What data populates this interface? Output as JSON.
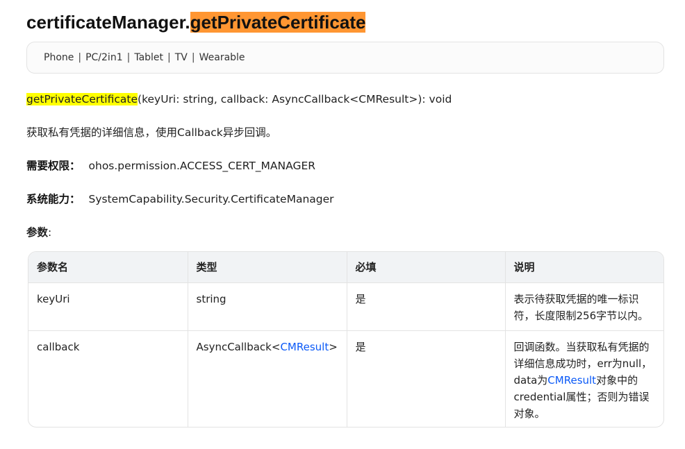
{
  "title": {
    "prefix": "certificateManager.",
    "highlight": "getPrivateCertificate"
  },
  "devices": [
    "Phone",
    "PC/2in1",
    "Tablet",
    "TV",
    "Wearable"
  ],
  "device_separator": "|",
  "signature": {
    "name": "getPrivateCertificate",
    "rest": "(keyUri: string, callback: AsyncCallback<CMResult>): void"
  },
  "description": "获取私有凭据的详细信息，使用Callback异步回调。",
  "permission": {
    "label": "需要权限：",
    "value": "ohos.permission.ACCESS_CERT_MANAGER"
  },
  "syscap": {
    "label": "系统能力：",
    "value": "SystemCapability.Security.CertificateManager"
  },
  "params_heading": {
    "label": "参数",
    "colon": ":"
  },
  "table": {
    "headers": [
      "参数名",
      "类型",
      "必填",
      "说明"
    ],
    "rows": [
      {
        "name": "keyUri",
        "type": "string",
        "required": "是",
        "desc": "表示待获取凭据的唯一标识符，长度限制256字节以内。"
      },
      {
        "name": "callback",
        "type_prefix": "AsyncCallback<",
        "type_link": "CMResult",
        "type_suffix": ">",
        "required": "是",
        "desc_before": "回调函数。当获取私有凭据的详细信息成功时，err为null，data为",
        "desc_link": "CMResult",
        "desc_after": "对象中的credential属性；否则为错误对象。"
      }
    ]
  },
  "colors": {
    "title_highlight": "#ff9632",
    "signature_highlight": "#ffff00",
    "link": "#0a59f7"
  }
}
